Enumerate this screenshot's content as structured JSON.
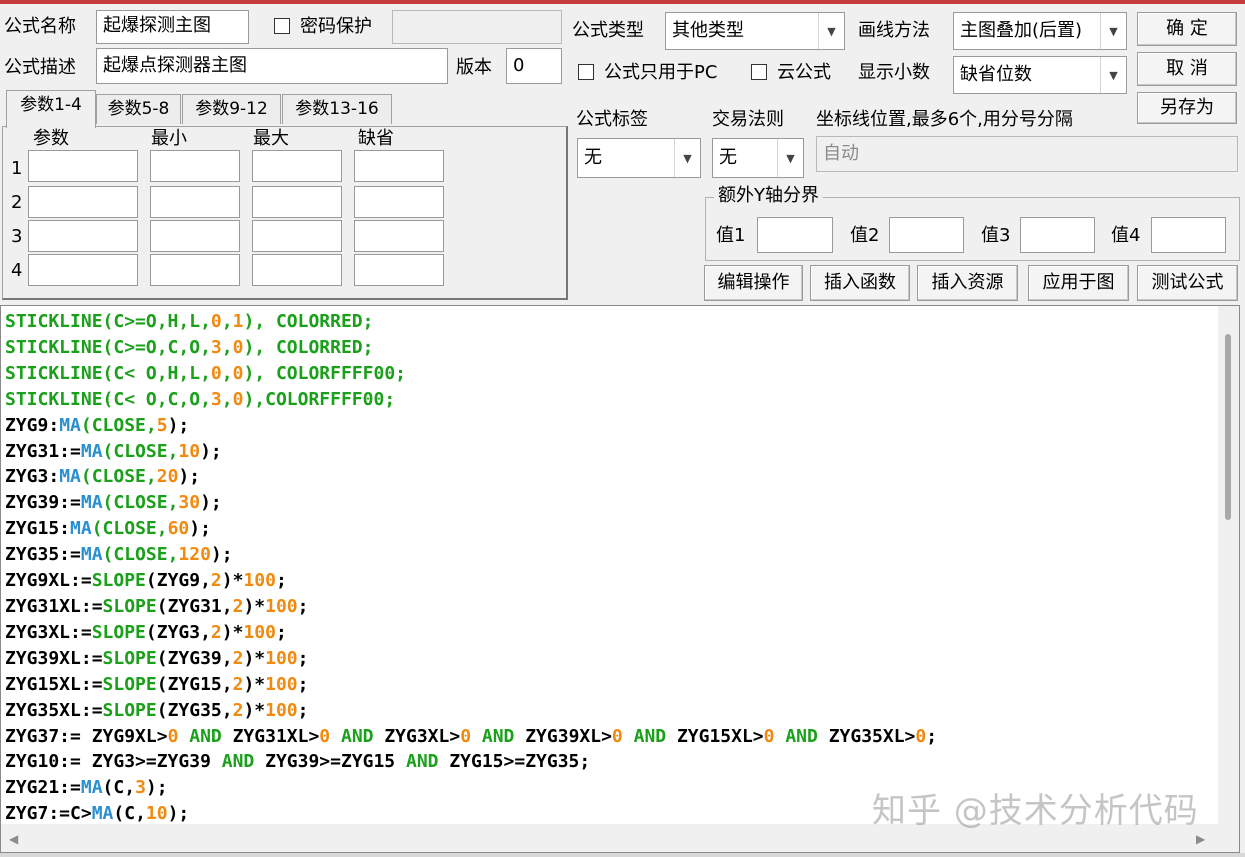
{
  "form": {
    "name_label": "公式名称",
    "name_value": "起爆探测主图",
    "password_label": "密码保护",
    "desc_label": "公式描述",
    "desc_value": "起爆点探测器主图",
    "version_label": "版本",
    "version_value": "0",
    "type_label": "公式类型",
    "type_value": "其他类型",
    "draw_label": "画线方法",
    "draw_value": "主图叠加(后置)",
    "pc_only_label": "公式只用于PC",
    "cloud_label": "云公式",
    "decimals_label": "显示小数",
    "decimals_value": "缺省位数",
    "tag_label": "公式标签",
    "tag_value": "无",
    "rule_label": "交易法则",
    "rule_value": "无",
    "axis_label": "坐标线位置,最多6个,用分号分隔",
    "axis_value": "自动"
  },
  "buttons": {
    "ok": "确  定",
    "cancel": "取  消",
    "save_as": "另存为",
    "edit": "编辑操作",
    "insert_func": "插入函数",
    "insert_res": "插入资源",
    "apply": "应用于图",
    "test": "测试公式"
  },
  "tabs": [
    "参数1-4",
    "参数5-8",
    "参数9-12",
    "参数13-16"
  ],
  "params": {
    "headers": [
      "参数",
      "最小",
      "最大",
      "缺省"
    ],
    "rows": [
      "1",
      "2",
      "3",
      "4"
    ]
  },
  "extra_y": {
    "title": "额外Y轴分界",
    "labels": [
      "值1",
      "值2",
      "值3",
      "值4"
    ]
  },
  "code_lines": [
    [
      {
        "t": "STICKLINE(C>=O,H,L,",
        "c": "fn"
      },
      {
        "t": "0",
        "c": "nm"
      },
      {
        "t": ",",
        "c": "fn"
      },
      {
        "t": "1",
        "c": "nm"
      },
      {
        "t": "), COLORRED;",
        "c": "fn"
      }
    ],
    [
      {
        "t": "STICKLINE(C>=O,C,O,",
        "c": "fn"
      },
      {
        "t": "3",
        "c": "nm"
      },
      {
        "t": ",",
        "c": "fn"
      },
      {
        "t": "0",
        "c": "nm"
      },
      {
        "t": "), COLORRED;",
        "c": "fn"
      }
    ],
    [
      {
        "t": "STICKLINE(C< O,H,L,",
        "c": "fn"
      },
      {
        "t": "0",
        "c": "nm"
      },
      {
        "t": ",",
        "c": "fn"
      },
      {
        "t": "0",
        "c": "nm"
      },
      {
        "t": "), COLORFFFF00;",
        "c": "fn"
      }
    ],
    [
      {
        "t": "STICKLINE(C< O,C,O,",
        "c": "fn"
      },
      {
        "t": "3",
        "c": "nm"
      },
      {
        "t": ",",
        "c": "fn"
      },
      {
        "t": "0",
        "c": "nm"
      },
      {
        "t": "),COLORFFFF00;",
        "c": "fn"
      }
    ],
    [
      {
        "t": "ZYG9:"
      },
      {
        "t": "MA",
        "c": "mi"
      },
      {
        "t": "(CLOSE,",
        "c": "fn"
      },
      {
        "t": "5",
        "c": "nm"
      },
      {
        "t": ");"
      }
    ],
    [
      {
        "t": "ZYG31:="
      },
      {
        "t": "MA",
        "c": "mi"
      },
      {
        "t": "(CLOSE,",
        "c": "fn"
      },
      {
        "t": "10",
        "c": "nm"
      },
      {
        "t": ");"
      }
    ],
    [
      {
        "t": "ZYG3:"
      },
      {
        "t": "MA",
        "c": "mi"
      },
      {
        "t": "(CLOSE,",
        "c": "fn"
      },
      {
        "t": "20",
        "c": "nm"
      },
      {
        "t": ");"
      }
    ],
    [
      {
        "t": "ZYG39:="
      },
      {
        "t": "MA",
        "c": "mi"
      },
      {
        "t": "(CLOSE,",
        "c": "fn"
      },
      {
        "t": "30",
        "c": "nm"
      },
      {
        "t": ");"
      }
    ],
    [
      {
        "t": "ZYG15:"
      },
      {
        "t": "MA",
        "c": "mi"
      },
      {
        "t": "(CLOSE,",
        "c": "fn"
      },
      {
        "t": "60",
        "c": "nm"
      },
      {
        "t": ");"
      }
    ],
    [
      {
        "t": "ZYG35:="
      },
      {
        "t": "MA",
        "c": "mi"
      },
      {
        "t": "(CLOSE,",
        "c": "fn"
      },
      {
        "t": "120",
        "c": "nm"
      },
      {
        "t": ");"
      }
    ],
    [
      {
        "t": "ZYG9XL:="
      },
      {
        "t": "SLOPE",
        "c": "fn"
      },
      {
        "t": "(ZYG9,"
      },
      {
        "t": "2",
        "c": "nm"
      },
      {
        "t": ")*"
      },
      {
        "t": "100",
        "c": "nm"
      },
      {
        "t": ";"
      }
    ],
    [
      {
        "t": "ZYG31XL:="
      },
      {
        "t": "SLOPE",
        "c": "fn"
      },
      {
        "t": "(ZYG31,"
      },
      {
        "t": "2",
        "c": "nm"
      },
      {
        "t": ")*"
      },
      {
        "t": "100",
        "c": "nm"
      },
      {
        "t": ";"
      }
    ],
    [
      {
        "t": "ZYG3XL:="
      },
      {
        "t": "SLOPE",
        "c": "fn"
      },
      {
        "t": "(ZYG3,"
      },
      {
        "t": "2",
        "c": "nm"
      },
      {
        "t": ")*"
      },
      {
        "t": "100",
        "c": "nm"
      },
      {
        "t": ";"
      }
    ],
    [
      {
        "t": "ZYG39XL:="
      },
      {
        "t": "SLOPE",
        "c": "fn"
      },
      {
        "t": "(ZYG39,"
      },
      {
        "t": "2",
        "c": "nm"
      },
      {
        "t": ")*"
      },
      {
        "t": "100",
        "c": "nm"
      },
      {
        "t": ";"
      }
    ],
    [
      {
        "t": "ZYG15XL:="
      },
      {
        "t": "SLOPE",
        "c": "fn"
      },
      {
        "t": "(ZYG15,"
      },
      {
        "t": "2",
        "c": "nm"
      },
      {
        "t": ")*"
      },
      {
        "t": "100",
        "c": "nm"
      },
      {
        "t": ";"
      }
    ],
    [
      {
        "t": "ZYG35XL:="
      },
      {
        "t": "SLOPE",
        "c": "fn"
      },
      {
        "t": "(ZYG35,"
      },
      {
        "t": "2",
        "c": "nm"
      },
      {
        "t": ")*"
      },
      {
        "t": "100",
        "c": "nm"
      },
      {
        "t": ";"
      }
    ],
    [
      {
        "t": "ZYG37:= ZYG9XL>"
      },
      {
        "t": "0",
        "c": "nm"
      },
      {
        "t": " AND ",
        "c": "fn"
      },
      {
        "t": "ZYG31XL>"
      },
      {
        "t": "0",
        "c": "nm"
      },
      {
        "t": " AND ",
        "c": "fn"
      },
      {
        "t": "ZYG3XL>"
      },
      {
        "t": "0",
        "c": "nm"
      },
      {
        "t": " AND ",
        "c": "fn"
      },
      {
        "t": "ZYG39XL>"
      },
      {
        "t": "0",
        "c": "nm"
      },
      {
        "t": " AND ",
        "c": "fn"
      },
      {
        "t": "ZYG15XL>"
      },
      {
        "t": "0",
        "c": "nm"
      },
      {
        "t": " AND ",
        "c": "fn"
      },
      {
        "t": "ZYG35XL>"
      },
      {
        "t": "0",
        "c": "nm"
      },
      {
        "t": ";"
      }
    ],
    [
      {
        "t": "ZYG10:= ZYG3>=ZYG39 "
      },
      {
        "t": "AND",
        "c": "fn"
      },
      {
        "t": " ZYG39>=ZYG15 "
      },
      {
        "t": "AND",
        "c": "fn"
      },
      {
        "t": " ZYG15>=ZYG35;"
      }
    ],
    [
      {
        "t": "ZYG21:="
      },
      {
        "t": "MA",
        "c": "mi"
      },
      {
        "t": "(C,"
      },
      {
        "t": "3",
        "c": "nm"
      },
      {
        "t": ");"
      }
    ],
    [
      {
        "t": "ZYG7:=C>"
      },
      {
        "t": "MA",
        "c": "mi"
      },
      {
        "t": "(C,"
      },
      {
        "t": "10",
        "c": "nm"
      },
      {
        "t": ");"
      }
    ]
  ],
  "watermark": "知乎 @技术分析代码"
}
